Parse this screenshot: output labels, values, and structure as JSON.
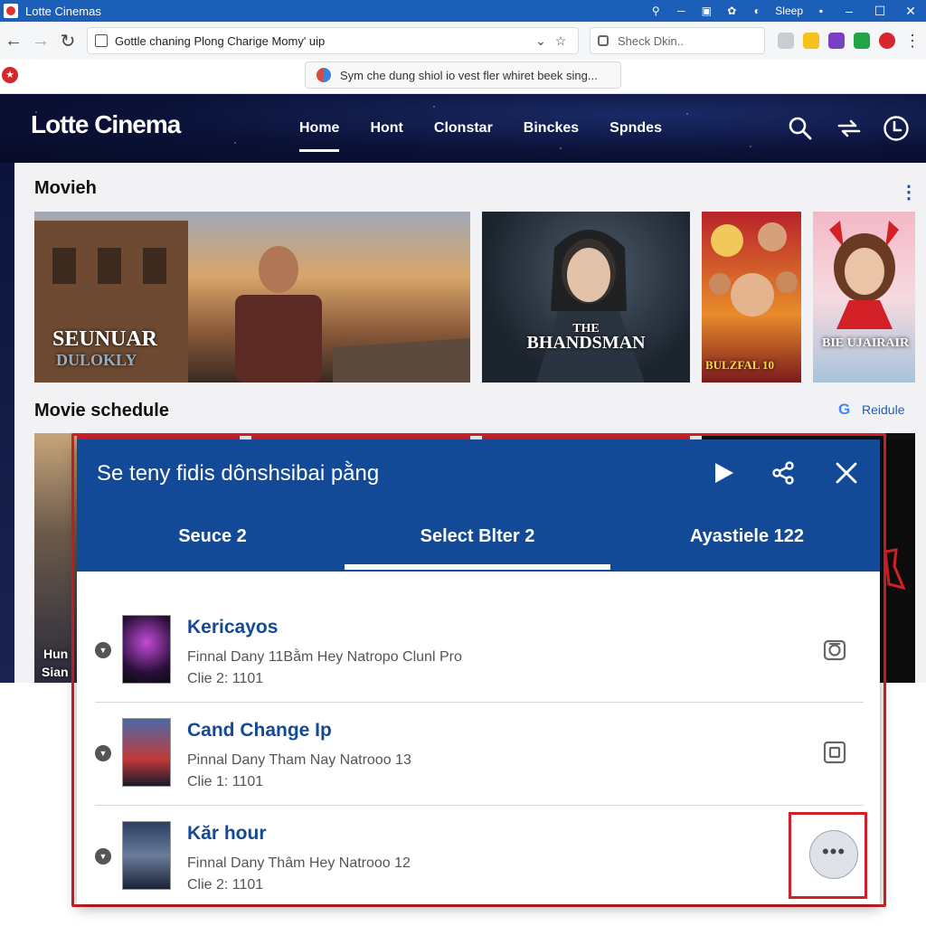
{
  "window": {
    "title": "Lotte Cinemas",
    "sleep_label": "Sleep"
  },
  "toolbar": {
    "address": "Gottle chaning Plong Charige Momy' uip",
    "search_placeholder": "Sheck Dkin.."
  },
  "infobar": {
    "notice": "Sym che dung shiol io vest fler whiret beek sing..."
  },
  "site": {
    "logo": "Lotte Cinema",
    "nav": [
      "Home",
      "Hont",
      "Clonstar",
      "Binckes",
      "Spndes"
    ]
  },
  "movies": {
    "title": "Movieh",
    "posters": [
      {
        "title_line1": "SEUNUAR",
        "title_line2": "DULOKLY"
      },
      {
        "title_line1": "THE",
        "title_line2": "BHANDSMAN"
      },
      {
        "title_line1": "",
        "title_line2": "BULZFAL 10"
      },
      {
        "title_line1": "BIE UJAIRAIR",
        "title_line2": ""
      }
    ]
  },
  "schedule": {
    "title": "Movie schedule",
    "link": "Reidule",
    "partial_caption_line1": "Hun",
    "partial_caption_line2": "Sian"
  },
  "modal": {
    "title": "Se teny fidis dônshsibai pằng",
    "tabs": [
      "Seuce 2",
      "Select Blter 2",
      "Ayastiele 122"
    ],
    "active_tab_index": 1,
    "items": [
      {
        "name": "Kericayos",
        "line1": "Finnal Dany 11Bằm Hey Natropo Clunl Pro",
        "line2": "Clie 2: 1101",
        "action_icon": "camera-icon"
      },
      {
        "name": "Cand Change Ip",
        "line1": "Pinnal Dany Tham Nay Natrooo 13",
        "line2": "Clie 1: 1101",
        "action_icon": "square-icon"
      },
      {
        "name": "Kăr hour",
        "line1": "Finnal Dany Thâm Hey Natrooo 12",
        "line2": "Clie 2: 1101",
        "action_icon": "more-icon"
      }
    ]
  },
  "colors": {
    "brand_blue": "#134a97",
    "highlight_red": "#d32026",
    "header_navy": "#0b1238"
  }
}
